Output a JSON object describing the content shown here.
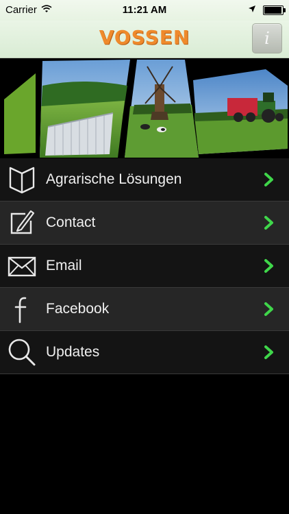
{
  "status_bar": {
    "carrier": "Carrier",
    "time": "11:21 AM",
    "icons": [
      "wifi-icon",
      "location-arrow-icon",
      "battery-icon"
    ]
  },
  "nav_bar": {
    "logo_text": "VOSSEN",
    "info_button_label": "i"
  },
  "banner": {
    "description_icons": [
      "greenhouse-photo",
      "windmill-photo",
      "tractor-photo"
    ]
  },
  "menu": {
    "items": [
      {
        "label": "Agrarische Lösungen",
        "icon": "book-icon"
      },
      {
        "label": "Contact",
        "icon": "pencil-note-icon"
      },
      {
        "label": "Email",
        "icon": "envelope-icon"
      },
      {
        "label": "Facebook",
        "icon": "facebook-icon"
      },
      {
        "label": "Updates",
        "icon": "search-icon"
      }
    ]
  },
  "colors": {
    "accent": "#ef8a2c",
    "chevron": "#3fd64a",
    "background": "#000000"
  }
}
